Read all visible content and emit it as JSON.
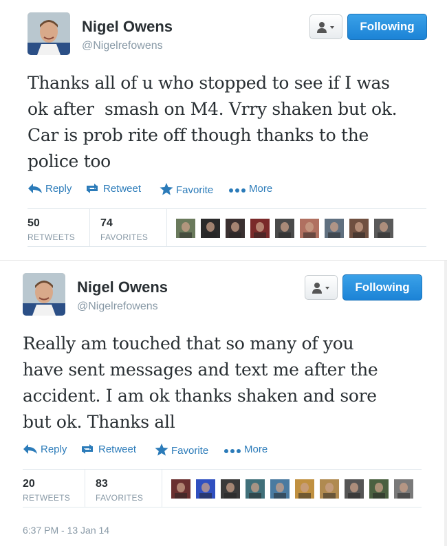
{
  "tweets": [
    {
      "display_name": "Nigel Owens",
      "handle": "@Nigelrefowens",
      "follow_label": "Following",
      "text": "Thanks all of u who stopped to see if I was\nok after  smash on M4. Vrry shaken but ok.\nCar is prob rite off though thanks to the\npolice too",
      "actions": {
        "reply": "Reply",
        "retweet": "Retweet",
        "favorite": "Favorite",
        "more": "More"
      },
      "retweets_count": "50",
      "retweets_label": "RETWEETS",
      "favorites_count": "74",
      "favorites_label": "FAVORITES",
      "faces": [
        "#6a7a5c",
        "#2a2a2a",
        "#3a3030",
        "#7a2a2a",
        "#4a4a4a",
        "#b07060",
        "#607080",
        "#705040",
        "#5a5a5a"
      ]
    },
    {
      "display_name": "Nigel Owens",
      "handle": "@Nigelrefowens",
      "follow_label": "Following",
      "text": "Really am touched that so many of you\nhave sent messages and text me after the\naccident. I am ok thanks shaken and sore\nbut ok. Thanks all",
      "actions": {
        "reply": "Reply",
        "retweet": "Retweet",
        "favorite": "Favorite",
        "more": "More"
      },
      "retweets_count": "20",
      "retweets_label": "RETWEETS",
      "favorites_count": "83",
      "favorites_label": "FAVORITES",
      "faces": [
        "#6a3030",
        "#3050c0",
        "#3a3a3a",
        "#40707a",
        "#4a7aa0",
        "#c09040",
        "#b08a50",
        "#555555",
        "#4a6040",
        "#7a7a7a"
      ],
      "timestamp": "6:37 PM - 13 Jan 14"
    }
  ],
  "colors": {
    "link": "#2b7bb9",
    "follow_button": "#2b8fe0",
    "muted": "#8899a6"
  },
  "icons": [
    "avatar",
    "person-dropdown-icon",
    "reply-icon",
    "retweet-icon",
    "star-icon",
    "more-dots-icon"
  ]
}
